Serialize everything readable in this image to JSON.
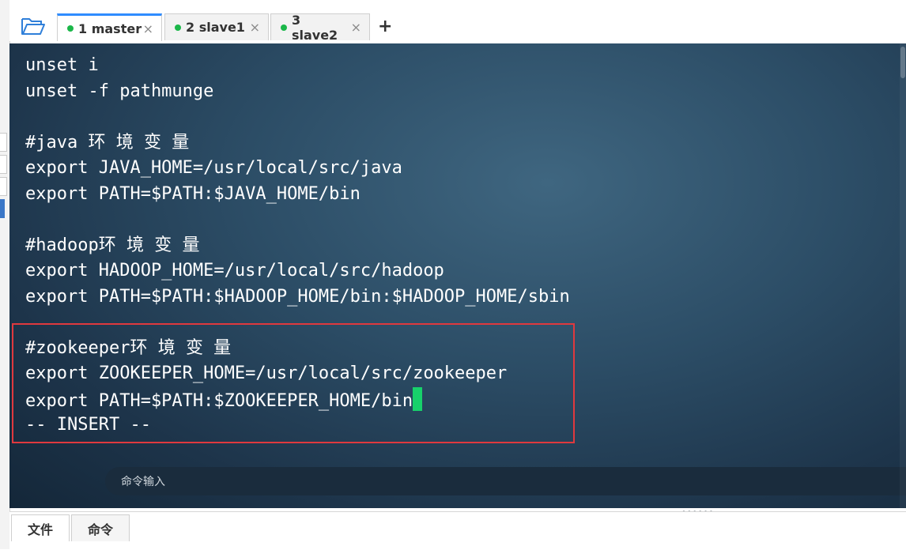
{
  "tabs": [
    {
      "label": "1 master",
      "active": true,
      "status_color": "#1bb749"
    },
    {
      "label": "2 slave1",
      "active": false,
      "status_color": "#1bb749"
    },
    {
      "label": "3 slave2",
      "active": false,
      "status_color": "#1bb749"
    }
  ],
  "tab_close_glyph": "×",
  "add_tab_glyph": "+",
  "terminal": {
    "lines": [
      "unset i",
      "unset -f pathmunge",
      "",
      "#java 环 境 变 量",
      "export JAVA_HOME=/usr/local/src/java",
      "export PATH=$PATH:$JAVA_HOME/bin",
      "",
      "#hadoop环 境 变 量",
      "export HADOOP_HOME=/usr/local/src/hadoop",
      "export PATH=$PATH:$HADOOP_HOME/bin:$HADOOP_HOME/sbin",
      "",
      "#zookeeper环 境 变 量",
      "export ZOOKEEPER_HOME=/usr/local/src/zookeeper",
      "export PATH=$PATH:$ZOOKEEPER_HOME/bin",
      "-- INSERT --"
    ],
    "cursor_color": "#17d16b",
    "highlight_color": "#e0393e"
  },
  "command_input": {
    "placeholder": "命令输入"
  },
  "bottom_tabs": [
    {
      "label": "文件",
      "active": true
    },
    {
      "label": "命令",
      "active": false
    }
  ],
  "icons": {
    "open_folder": "folder-open-icon"
  }
}
